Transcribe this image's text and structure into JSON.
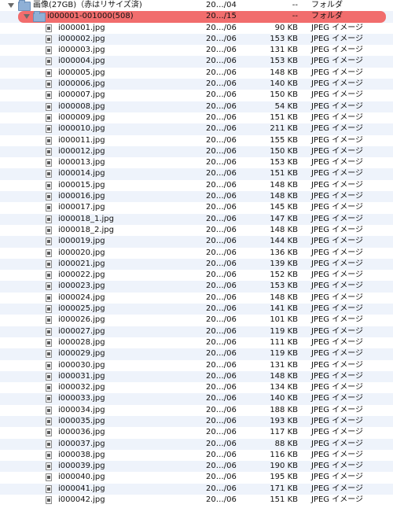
{
  "root_folder": {
    "name": "画像(27GB)（赤はリサイズ済)",
    "date": "20…/04",
    "size": "--",
    "kind": "フォルダ"
  },
  "sub_folder": {
    "name": "i000001-001000(508)",
    "date": "20…/15",
    "size": "--",
    "kind": "フォルダ"
  },
  "files": [
    {
      "name": "i000001.jpg",
      "date": "20…/06",
      "size": "90 KB",
      "kind": "JPEG イメージ"
    },
    {
      "name": "i000002.jpg",
      "date": "20…/06",
      "size": "153 KB",
      "kind": "JPEG イメージ"
    },
    {
      "name": "i000003.jpg",
      "date": "20…/06",
      "size": "131 KB",
      "kind": "JPEG イメージ"
    },
    {
      "name": "i000004.jpg",
      "date": "20…/06",
      "size": "153 KB",
      "kind": "JPEG イメージ"
    },
    {
      "name": "i000005.jpg",
      "date": "20…/06",
      "size": "148 KB",
      "kind": "JPEG イメージ"
    },
    {
      "name": "i000006.jpg",
      "date": "20…/06",
      "size": "140 KB",
      "kind": "JPEG イメージ"
    },
    {
      "name": "i000007.jpg",
      "date": "20…/06",
      "size": "150 KB",
      "kind": "JPEG イメージ"
    },
    {
      "name": "i000008.jpg",
      "date": "20…/06",
      "size": "54 KB",
      "kind": "JPEG イメージ"
    },
    {
      "name": "i000009.jpg",
      "date": "20…/06",
      "size": "151 KB",
      "kind": "JPEG イメージ"
    },
    {
      "name": "i000010.jpg",
      "date": "20…/06",
      "size": "211 KB",
      "kind": "JPEG イメージ"
    },
    {
      "name": "i000011.jpg",
      "date": "20…/06",
      "size": "155 KB",
      "kind": "JPEG イメージ"
    },
    {
      "name": "i000012.jpg",
      "date": "20…/06",
      "size": "150 KB",
      "kind": "JPEG イメージ"
    },
    {
      "name": "i000013.jpg",
      "date": "20…/06",
      "size": "153 KB",
      "kind": "JPEG イメージ"
    },
    {
      "name": "i000014.jpg",
      "date": "20…/06",
      "size": "151 KB",
      "kind": "JPEG イメージ"
    },
    {
      "name": "i000015.jpg",
      "date": "20…/06",
      "size": "148 KB",
      "kind": "JPEG イメージ"
    },
    {
      "name": "i000016.jpg",
      "date": "20…/06",
      "size": "148 KB",
      "kind": "JPEG イメージ"
    },
    {
      "name": "i000017.jpg",
      "date": "20…/06",
      "size": "145 KB",
      "kind": "JPEG イメージ"
    },
    {
      "name": "i000018_1.jpg",
      "date": "20…/06",
      "size": "147 KB",
      "kind": "JPEG イメージ"
    },
    {
      "name": "i000018_2.jpg",
      "date": "20…/06",
      "size": "148 KB",
      "kind": "JPEG イメージ"
    },
    {
      "name": "i000019.jpg",
      "date": "20…/06",
      "size": "144 KB",
      "kind": "JPEG イメージ"
    },
    {
      "name": "i000020.jpg",
      "date": "20…/06",
      "size": "136 KB",
      "kind": "JPEG イメージ"
    },
    {
      "name": "i000021.jpg",
      "date": "20…/06",
      "size": "139 KB",
      "kind": "JPEG イメージ"
    },
    {
      "name": "i000022.jpg",
      "date": "20…/06",
      "size": "152 KB",
      "kind": "JPEG イメージ"
    },
    {
      "name": "i000023.jpg",
      "date": "20…/06",
      "size": "153 KB",
      "kind": "JPEG イメージ"
    },
    {
      "name": "i000024.jpg",
      "date": "20…/06",
      "size": "148 KB",
      "kind": "JPEG イメージ"
    },
    {
      "name": "i000025.jpg",
      "date": "20…/06",
      "size": "141 KB",
      "kind": "JPEG イメージ"
    },
    {
      "name": "i000026.jpg",
      "date": "20…/06",
      "size": "101 KB",
      "kind": "JPEG イメージ"
    },
    {
      "name": "i000027.jpg",
      "date": "20…/06",
      "size": "119 KB",
      "kind": "JPEG イメージ"
    },
    {
      "name": "i000028.jpg",
      "date": "20…/06",
      "size": "111 KB",
      "kind": "JPEG イメージ"
    },
    {
      "name": "i000029.jpg",
      "date": "20…/06",
      "size": "119 KB",
      "kind": "JPEG イメージ"
    },
    {
      "name": "i000030.jpg",
      "date": "20…/06",
      "size": "131 KB",
      "kind": "JPEG イメージ"
    },
    {
      "name": "i000031.jpg",
      "date": "20…/06",
      "size": "148 KB",
      "kind": "JPEG イメージ"
    },
    {
      "name": "i000032.jpg",
      "date": "20…/06",
      "size": "134 KB",
      "kind": "JPEG イメージ"
    },
    {
      "name": "i000033.jpg",
      "date": "20…/06",
      "size": "140 KB",
      "kind": "JPEG イメージ"
    },
    {
      "name": "i000034.jpg",
      "date": "20…/06",
      "size": "188 KB",
      "kind": "JPEG イメージ"
    },
    {
      "name": "i000035.jpg",
      "date": "20…/06",
      "size": "193 KB",
      "kind": "JPEG イメージ"
    },
    {
      "name": "i000036.jpg",
      "date": "20…/06",
      "size": "117 KB",
      "kind": "JPEG イメージ"
    },
    {
      "name": "i000037.jpg",
      "date": "20…/06",
      "size": "88 KB",
      "kind": "JPEG イメージ"
    },
    {
      "name": "i000038.jpg",
      "date": "20…/06",
      "size": "116 KB",
      "kind": "JPEG イメージ"
    },
    {
      "name": "i000039.jpg",
      "date": "20…/06",
      "size": "190 KB",
      "kind": "JPEG イメージ"
    },
    {
      "name": "i000040.jpg",
      "date": "20…/06",
      "size": "195 KB",
      "kind": "JPEG イメージ"
    },
    {
      "name": "i000041.jpg",
      "date": "20…/06",
      "size": "171 KB",
      "kind": "JPEG イメージ"
    },
    {
      "name": "i000042.jpg",
      "date": "20…/06",
      "size": "151 KB",
      "kind": "JPEG イメージ"
    }
  ],
  "colors": {
    "selected_row": "#f16d6d",
    "alt_row": "#eef3fb",
    "folder": "#8fb0d6"
  },
  "icons": {
    "folder": "folder-icon",
    "file": "jpeg-thumbnail-icon",
    "disclosure": "disclosure-triangle-icon"
  }
}
